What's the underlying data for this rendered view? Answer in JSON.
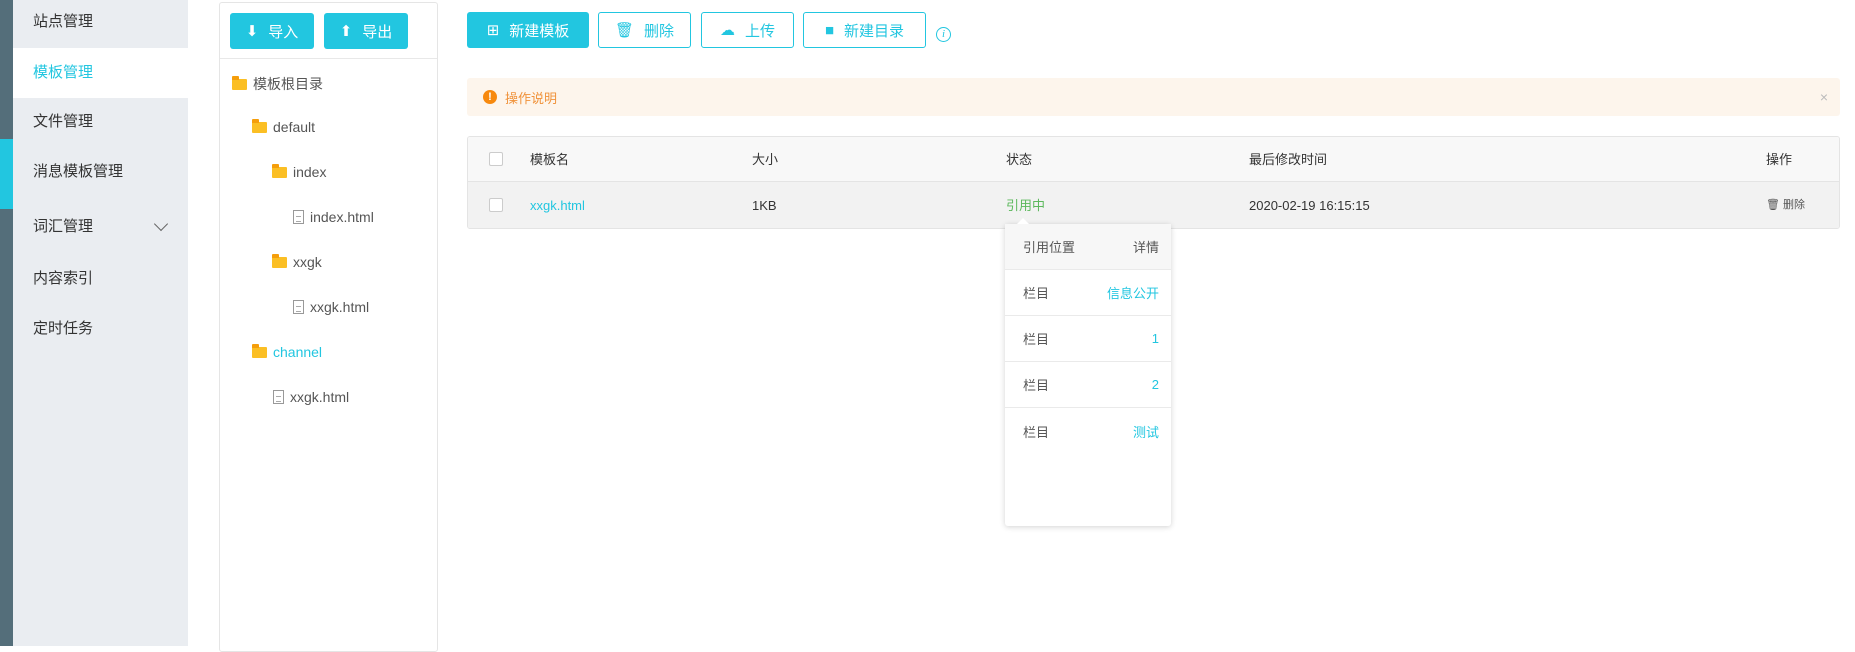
{
  "sidebar": {
    "items": [
      {
        "label": "站点管理"
      },
      {
        "label": "模板管理",
        "active": true
      },
      {
        "label": "文件管理"
      },
      {
        "label": "消息模板管理"
      },
      {
        "label": "词汇管理"
      },
      {
        "label": "内容索引"
      },
      {
        "label": "定时任务"
      }
    ]
  },
  "tree": {
    "import_label": "导入",
    "export_label": "导出",
    "nodes": [
      {
        "label": "模板根目录",
        "type": "folder"
      },
      {
        "label": "default",
        "type": "folder"
      },
      {
        "label": "index",
        "type": "folder"
      },
      {
        "label": "index.html",
        "type": "file"
      },
      {
        "label": "xxgk",
        "type": "folder"
      },
      {
        "label": "xxgk.html",
        "type": "file"
      },
      {
        "label": "channel",
        "type": "folder",
        "selected": true
      },
      {
        "label": "xxgk.html",
        "type": "file"
      }
    ]
  },
  "toolbar": {
    "new_template": "新建模板",
    "delete": "删除",
    "upload": "上传",
    "new_dir": "新建目录"
  },
  "alert": {
    "text": "操作说明",
    "close": "×"
  },
  "table": {
    "headers": [
      "模板名",
      "大小",
      "状态",
      "最后修改时间",
      "操作"
    ],
    "rows": [
      {
        "name": "xxgk.html",
        "size": "1KB",
        "status": "引用中",
        "modified": "2020-02-19 16:15:15",
        "action": "删除"
      }
    ]
  },
  "popover": {
    "header": [
      "引用位置",
      "详情"
    ],
    "rows": [
      {
        "k": "栏目",
        "v": "信息公开"
      },
      {
        "k": "栏目",
        "v": "1"
      },
      {
        "k": "栏目",
        "v": "2"
      },
      {
        "k": "栏目",
        "v": "测试"
      }
    ]
  },
  "colors": {
    "accent": "#22c6e0",
    "status_green": "#5cb85c",
    "warning": "#f7890e"
  }
}
